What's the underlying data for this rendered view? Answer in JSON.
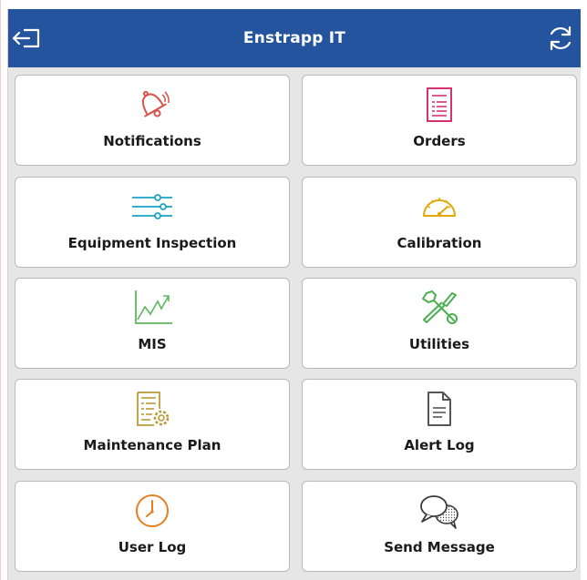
{
  "header": {
    "title": "Enstrapp IT",
    "background_color": "#24549e",
    "left_icon": "logout-icon",
    "right_icon": "refresh-icon"
  },
  "tiles": [
    {
      "label": "Notifications",
      "icon": "bell-icon",
      "color": "#d9534f"
    },
    {
      "label": "Orders",
      "icon": "document-list-icon",
      "color": "#d6336c"
    },
    {
      "label": "Equipment Inspection",
      "icon": "sliders-icon",
      "color": "#1aa3c7"
    },
    {
      "label": "Calibration",
      "icon": "gauge-icon",
      "color": "#e0a800"
    },
    {
      "label": "MIS",
      "icon": "line-chart-icon",
      "color": "#5cb85c"
    },
    {
      "label": "Utilities",
      "icon": "tools-icon",
      "color": "#4caf50"
    },
    {
      "label": "Maintenance Plan",
      "icon": "plan-gear-icon",
      "color": "#b89b3a"
    },
    {
      "label": "Alert Log",
      "icon": "file-icon",
      "color": "#555555"
    },
    {
      "label": "User Log",
      "icon": "clock-icon",
      "color": "#e67e22"
    },
    {
      "label": "Send Message",
      "icon": "chat-bubbles-icon",
      "color": "#3a3a3a"
    }
  ]
}
